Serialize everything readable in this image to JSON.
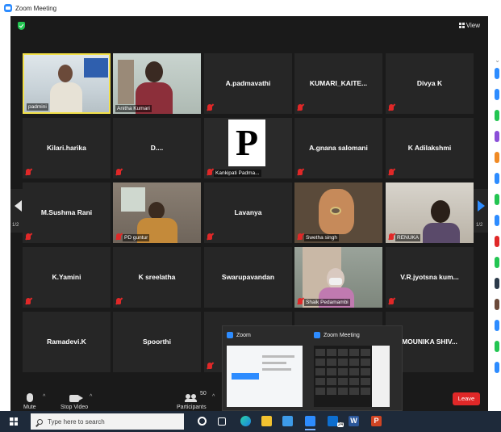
{
  "window": {
    "title": "Zoom Meeting"
  },
  "meeting": {
    "view_label": "View",
    "page_left": "1/2",
    "page_right": "1/2",
    "tiles": [
      {
        "name": "padmini",
        "kind": "video",
        "video": "padmini",
        "active": true,
        "muted": false
      },
      {
        "name": "Anitha Kumari",
        "kind": "video",
        "video": "anitha",
        "muted": false
      },
      {
        "name": "A.padmavathi",
        "kind": "name",
        "muted": true
      },
      {
        "name": "KUMARI_KAITE...",
        "kind": "name",
        "muted": true
      },
      {
        "name": "Divya K",
        "kind": "name",
        "muted": true
      },
      {
        "name": "Kilari.harika",
        "kind": "name",
        "muted": true
      },
      {
        "name": "D....",
        "kind": "name",
        "muted": true
      },
      {
        "name": "Kankipati Padma...",
        "kind": "video",
        "video": "p",
        "muted": true,
        "card_letter": "P"
      },
      {
        "name": "A.gnana salomani",
        "kind": "name",
        "muted": true
      },
      {
        "name": "K Adilakshmi",
        "kind": "name",
        "muted": true
      },
      {
        "name": "M.Sushma Rani",
        "kind": "name",
        "muted": true
      },
      {
        "name": "PD guntur",
        "kind": "video",
        "video": "pd",
        "muted": true
      },
      {
        "name": "Lavanya",
        "kind": "name",
        "muted": true
      },
      {
        "name": "Swetha singh",
        "kind": "video",
        "video": "swetha",
        "muted": true
      },
      {
        "name": "RENUKA",
        "kind": "video",
        "video": "renuka",
        "muted": true
      },
      {
        "name": "K.Yamini",
        "kind": "name",
        "muted": true
      },
      {
        "name": "K sreelatha",
        "kind": "name",
        "muted": true
      },
      {
        "name": "Swarupavandan",
        "kind": "name",
        "muted": false
      },
      {
        "name": "Shaik Pedamambi",
        "kind": "video",
        "video": "shaik",
        "muted": true
      },
      {
        "name": "V.R.jyotsna kum...",
        "kind": "name",
        "muted": true
      },
      {
        "name": "Ramadevi.K",
        "kind": "name",
        "muted": false
      },
      {
        "name": "Spoorthi",
        "kind": "name",
        "muted": false
      },
      {
        "name": "",
        "kind": "name",
        "muted": true
      },
      {
        "name": "",
        "kind": "name",
        "muted": false
      },
      {
        "name": "MOUNIKA SHIV...",
        "kind": "name",
        "muted": false
      }
    ]
  },
  "controls": {
    "mute_label": "Mute",
    "video_label": "Stop Video",
    "participants_label": "Participants",
    "participants_count": "50",
    "leave_label": "Leave"
  },
  "popup": {
    "items": [
      {
        "title": "Zoom"
      },
      {
        "title": "Zoom Meeting"
      }
    ]
  },
  "taskbar": {
    "search_placeholder": "Type here to search",
    "calendar_badge": "24"
  },
  "colors": {
    "accent": "#2d8cff",
    "muted_red": "#e02828",
    "active_border": "#f2e04a",
    "meeting_bg": "#1a1a1a",
    "tile_bg": "#262626"
  }
}
